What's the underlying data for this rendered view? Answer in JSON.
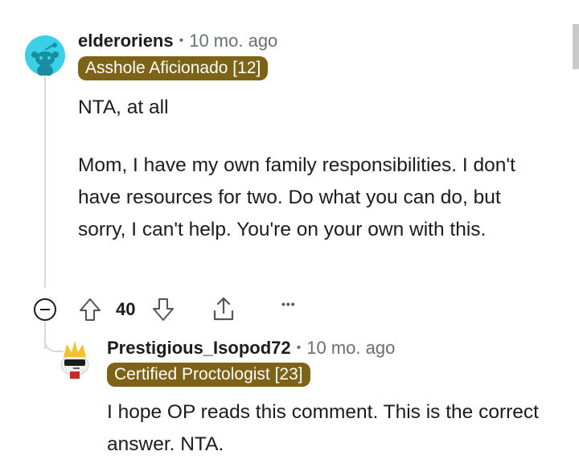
{
  "comment": {
    "username": "elderoriens",
    "separator": "•",
    "time": "10 mo. ago",
    "flair": "Asshole Aficionado [12]",
    "paragraphs": [
      "NTA, at all",
      "Mom, I have my own family responsibilities. I don't have resources for two. Do what you can do, but sorry, I can't help. You're on your own with this."
    ],
    "vote_count": "40",
    "more_icon": "•••"
  },
  "reply": {
    "username": "Prestigious_Isopod72",
    "separator": "•",
    "time": "10 mo. ago",
    "flair": "Certified Proctologist [23]",
    "paragraphs": [
      "I hope OP reads this comment. This is the correct answer. NTA."
    ]
  },
  "icons": {
    "avatar_1": "snoo-avatar-icon",
    "avatar_2": "snoo-sunglasses-avatar-icon",
    "collapse": "collapse-minus-icon",
    "upvote": "upvote-arrow-icon",
    "downvote": "downvote-arrow-icon",
    "share": "share-icon",
    "more": "more-options-icon"
  },
  "colors": {
    "flair_bg": "#7d6318",
    "avatar_1_bg": "#3ad1e8",
    "meta_text": "#6a6f73",
    "thread_line": "#d8d8d8"
  }
}
